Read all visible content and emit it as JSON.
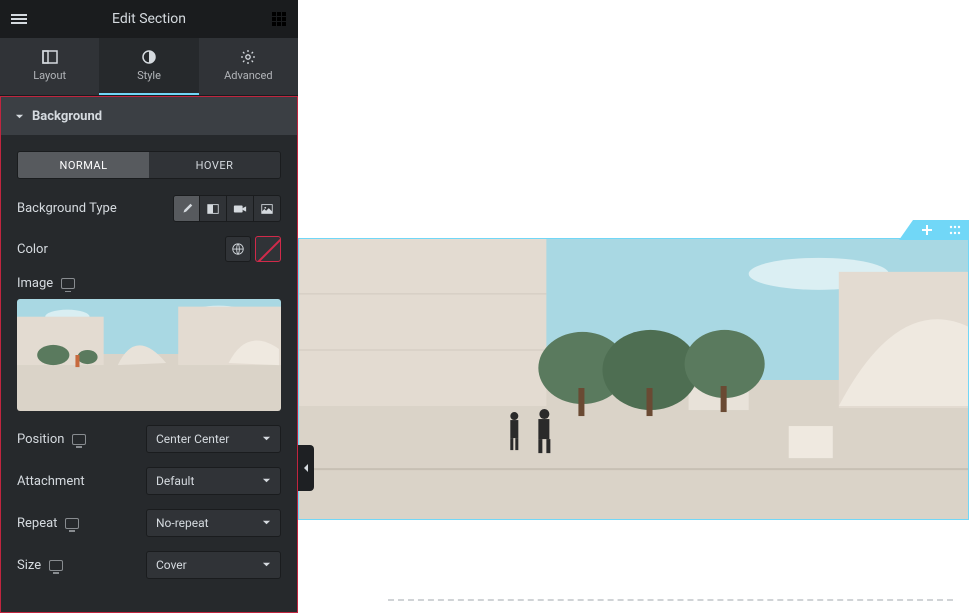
{
  "header": {
    "title": "Edit Section"
  },
  "tabs": {
    "layout": "Layout",
    "style": "Style",
    "advanced": "Advanced",
    "active": "style"
  },
  "section_title": "Background",
  "state_tabs": {
    "normal": "NORMAL",
    "hover": "HOVER",
    "active": "normal"
  },
  "labels": {
    "background_type": "Background Type",
    "color": "Color",
    "image": "Image",
    "position": "Position",
    "attachment": "Attachment",
    "repeat": "Repeat",
    "size": "Size"
  },
  "values": {
    "position": "Center Center",
    "attachment": "Default",
    "repeat": "No-repeat",
    "size": "Cover"
  },
  "colors": {
    "panel_bg": "#26292c",
    "accent": "#71d7f7",
    "highlight_border": "#c0253f",
    "sky": "#a9d8e3",
    "wall": "#e3dbd1",
    "ground": "#dad3c8",
    "tree": "#5a7a5e"
  }
}
